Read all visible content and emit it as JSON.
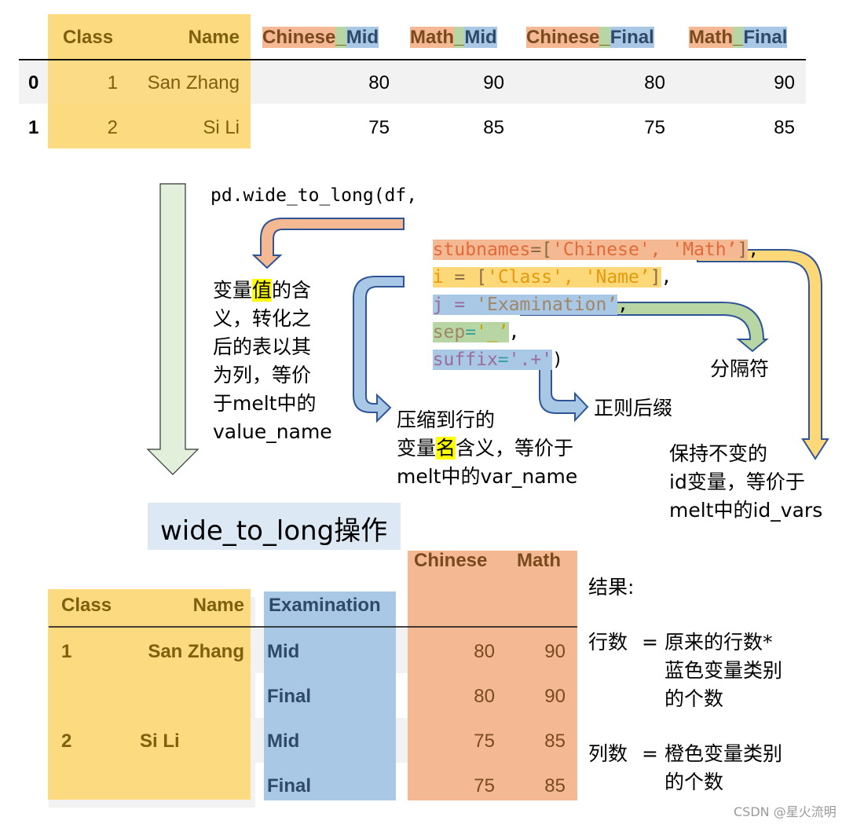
{
  "colors": {
    "id_yellow": "#fcd879",
    "stub_orange": "#f4b993",
    "sep_green": "#b7d6a3",
    "suffix_blue": "#a9c8e6",
    "arrow_stroke": "#2f5597",
    "down_arrow_green": "#e2efda",
    "highlight_yellow": "#ffff00",
    "title_bg": "#dce8f4"
  },
  "wide_table": {
    "headers": {
      "class": "Class",
      "name": "Name",
      "cols": [
        {
          "stub": "Chinese",
          "sep": "_",
          "suffix": "Mid"
        },
        {
          "stub": "Math",
          "sep": "_",
          "suffix": "Mid"
        },
        {
          "stub": "Chinese",
          "sep": "_",
          "suffix": "Final"
        },
        {
          "stub": "Math",
          "sep": "_",
          "suffix": "Final"
        }
      ]
    },
    "rows": [
      {
        "index": "0",
        "class": "1",
        "name": "San Zhang",
        "values": [
          "80",
          "90",
          "80",
          "90"
        ]
      },
      {
        "index": "1",
        "class": "2",
        "name": "Si Li",
        "values": [
          "75",
          "85",
          "75",
          "85"
        ]
      }
    ]
  },
  "code": {
    "line1": "pd.wide_to_long(df,",
    "stubnames": {
      "key": "stubnames",
      "eq": "=",
      "open": "[",
      "v1": "'Chinese'",
      "comma": ", ",
      "v2": "'Math’",
      "close": "]",
      "trail": ","
    },
    "i": {
      "key": "i ",
      "eq": "=",
      "sp": " ",
      "open": "[",
      "v1": "'Class'",
      "comma": ", ",
      "v2": "'Name’",
      "close": "]",
      "trail": ","
    },
    "j": {
      "key": "j ",
      "eq": "=",
      "sp": " ",
      "v": "'Examination’",
      "trail": ","
    },
    "sep": {
      "key": "sep",
      "eq": "=",
      "v": "'_’",
      "trail": ","
    },
    "suffix": {
      "key": "suffix",
      "eq": "=",
      "v": "'.+'",
      "trail": ")"
    }
  },
  "notes": {
    "value_name": {
      "pre": "变量",
      "highlight": "值",
      "post_lines": [
        "的含",
        "义，转化之",
        "后的表以其",
        "为列，等价",
        "于melt中的",
        "value_name"
      ]
    },
    "var_name": {
      "line1": "压缩到行的",
      "pre": "变量",
      "highlight": "名",
      "post": "含义，等价于",
      "line3": "melt中的var_name"
    },
    "regex_suffix": "正则后缀",
    "separator": "分隔符",
    "id_vars": [
      "保持不变的",
      "id变量，等价于",
      "melt中的id_vars"
    ]
  },
  "operation_title": "wide_to_long操作",
  "long_table": {
    "headers": {
      "class": "Class",
      "name": "Name",
      "examination": "Examination",
      "chinese": "Chinese",
      "math": "Math"
    },
    "rows": [
      {
        "class": "1",
        "name": "San Zhang",
        "examination": "Mid",
        "chinese": "80",
        "math": "90"
      },
      {
        "class": "",
        "name": "",
        "examination": "Final",
        "chinese": "80",
        "math": "90"
      },
      {
        "class": "2",
        "name": "Si Li",
        "examination": "Mid",
        "chinese": "75",
        "math": "85"
      },
      {
        "class": "",
        "name": "",
        "examination": "Final",
        "chinese": "75",
        "math": "85"
      }
    ]
  },
  "result": {
    "label": "结果:",
    "rows_label": "行数",
    "eq": "=",
    "rows_formula": [
      "原来的行数*",
      "蓝色变量类别",
      "的个数"
    ],
    "cols_label": "列数",
    "cols_formula": [
      "橙色变量类别",
      "的个数"
    ]
  },
  "watermark": "CSDN @星火流明"
}
